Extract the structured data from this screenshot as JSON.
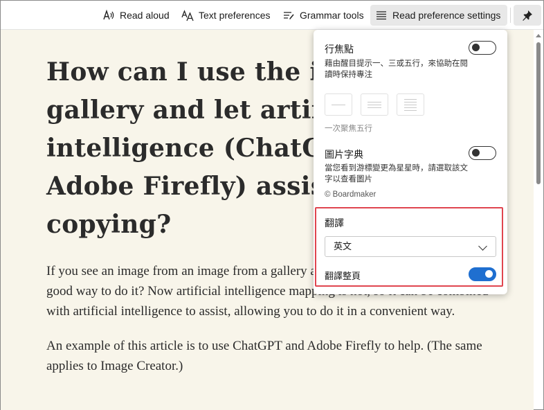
{
  "toolbar": {
    "read_aloud": "Read aloud",
    "text_preferences": "Text preferences",
    "grammar_tools": "Grammar tools",
    "read_preference_settings": "Read preference settings"
  },
  "article": {
    "title": "How can I use the image gallery and let artificial intelligence (ChatGPT and Adobe Firefly) assist in copying?",
    "title_visible": "How can I use the in\ngallery and let artifi\nintelligence (ChatGP\nAdobe Firefly) assist\ncopying?",
    "paragraphs": [
      "If you see an image from an image from a gallery and want to copy it, what is a good way to do it? Now artificial intelligence mapping is hot, so it can be combined with artificial intelligence to assist, allowing you to do it in a convenient way.",
      "An example of this article is to use ChatGPT and Adobe Firefly to help. (The same applies to Image Creator.)"
    ]
  },
  "panel": {
    "line_focus": {
      "title": "行焦點",
      "description": "藉由醒目提示一、三或五行，來協助在閱讀時保持專注",
      "enabled": false,
      "spacing_caption": "一次聚焦五行"
    },
    "picture_dictionary": {
      "title": "圖片字典",
      "description": "當您看到游標變更為星星時，請選取該文字以查看圖片",
      "attribution": "© Boardmaker",
      "enabled": false
    },
    "translate": {
      "title": "翻譯",
      "language": "英文",
      "translate_page_label": "翻譯整頁",
      "translate_page_enabled": true
    }
  },
  "colors": {
    "reader_background": "#f8f5ea",
    "toggle_on": "#1f6fd0",
    "highlight_border": "#e0454f"
  }
}
